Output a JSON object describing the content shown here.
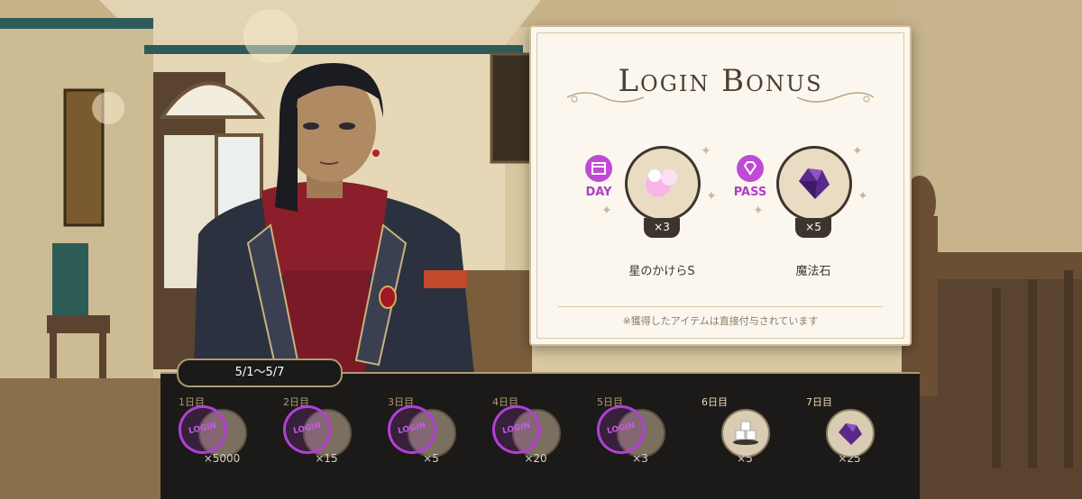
{
  "login_bonus": {
    "title": "Login Bonus",
    "rewards": [
      {
        "type_label": "DAY",
        "item_name": "星のかけらS",
        "quantity": "×3",
        "badge_icon": "calendar-icon"
      },
      {
        "type_label": "PASS",
        "item_name": "魔法石",
        "quantity": "×5",
        "badge_icon": "gem-icon"
      }
    ],
    "note": "※獲得したアイテムは直接付与されています"
  },
  "weekly": {
    "date_range": "5/1～5/7",
    "days": [
      {
        "label": "1日目",
        "quantity": "×5000",
        "claimed": true,
        "item_icon": "madol-icon"
      },
      {
        "label": "2日目",
        "quantity": "×15",
        "claimed": true,
        "item_icon": "magic-stone-icon"
      },
      {
        "label": "3日目",
        "quantity": "×5",
        "claimed": true,
        "item_icon": "cupcake-icon"
      },
      {
        "label": "4日目",
        "quantity": "×20",
        "claimed": true,
        "item_icon": "magic-stone-icon"
      },
      {
        "label": "5日目",
        "quantity": "×3",
        "claimed": true,
        "item_icon": "star-shard-icon"
      },
      {
        "label": "6日目",
        "quantity": "×5",
        "claimed": false,
        "item_icon": "sugar-cubes-icon"
      },
      {
        "label": "7日目",
        "quantity": "×25",
        "claimed": false,
        "item_icon": "magic-stone-icon"
      }
    ],
    "stamp_text": "LOGIN"
  },
  "colors": {
    "accent_purple": "#c04ad6",
    "card_bg": "#fbf7ee",
    "strip_bg": "#1c1a18",
    "gold_border": "#b09a72"
  }
}
